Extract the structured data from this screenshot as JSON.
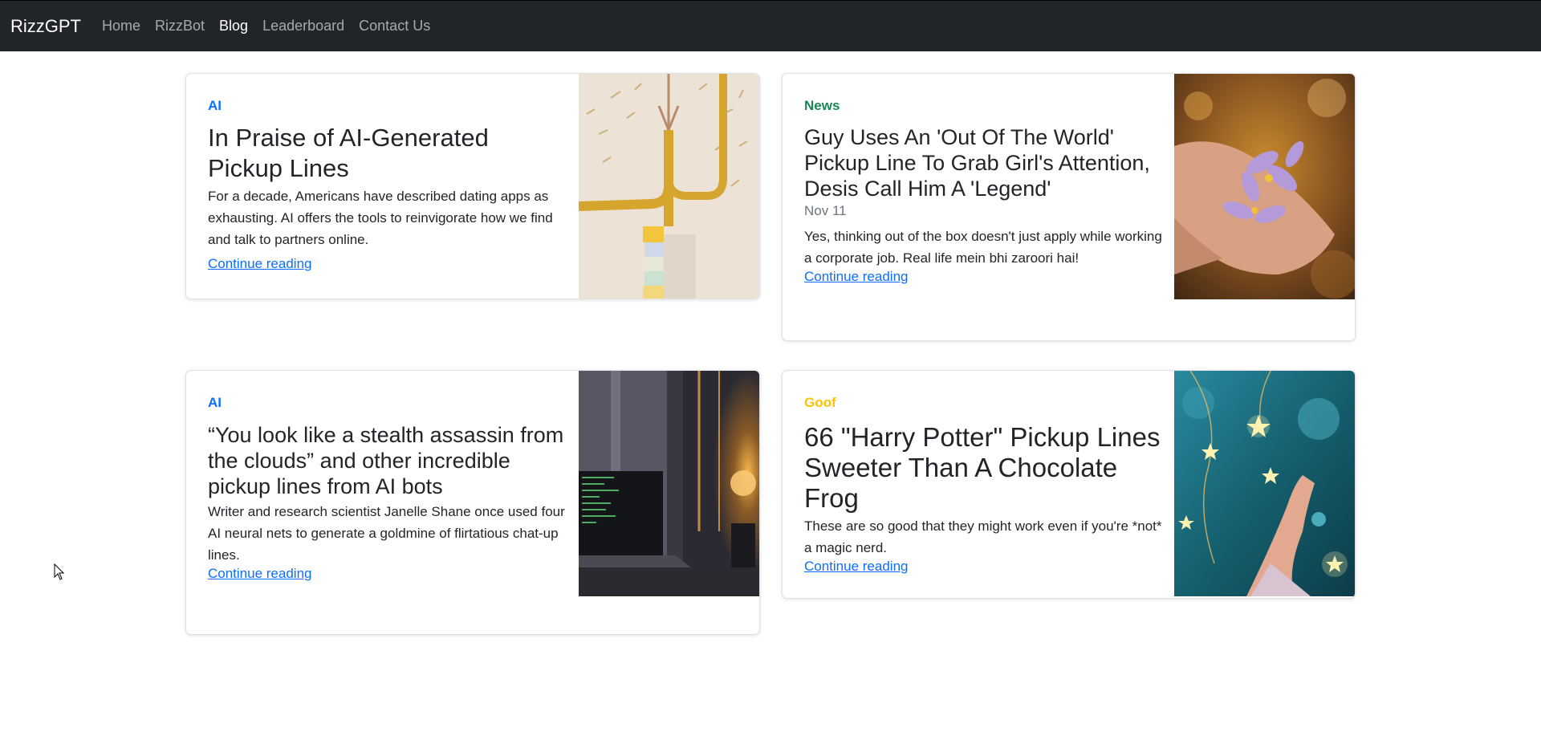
{
  "navbar": {
    "brand": "RizzGPT",
    "links": [
      {
        "label": "Home",
        "active": false
      },
      {
        "label": "RizzBot",
        "active": false
      },
      {
        "label": "Blog",
        "active": true
      },
      {
        "label": "Leaderboard",
        "active": false
      },
      {
        "label": "Contact Us",
        "active": false
      }
    ]
  },
  "posts": [
    {
      "category": "AI",
      "category_color": "#0d6efd",
      "title": "In Praise of AI-Generated Pickup Lines",
      "date": "",
      "excerpt": "For a decade, Americans have described dating apps as exhausting. AI offers the tools to reinvigorate how we find and talk to partners online.",
      "link": "Continue reading",
      "image": "toy-train-tracks-photo"
    },
    {
      "category": "News",
      "category_color": "#198754",
      "title": "Guy Uses An 'Out Of The World' Pickup Line To Grab Girl's Attention, Desis Call Him A 'Legend'",
      "date": "Nov 11",
      "excerpt": "Yes, thinking out of the box doesn't just apply while working a corporate job. Real life mein bhi zaroori hai!",
      "link": "Continue reading",
      "image": "hand-holding-purple-flowers-photo"
    },
    {
      "category": "AI",
      "category_color": "#0d6efd",
      "title": "“You look like a stealth assassin from the clouds” and other incredible pickup lines from AI bots",
      "date": "",
      "excerpt": "Writer and research scientist Janelle Shane once used four AI neural nets to generate a goldmine of flirtatious chat-up lines.",
      "link": "Continue reading",
      "image": "laptop-and-lamp-photo"
    },
    {
      "category": "Goof",
      "category_color": "#ffc107",
      "title": "66 \"Harry Potter\" Pickup Lines Sweeter Than A Chocolate Frog",
      "date": "",
      "excerpt": "These are so good that they might work even if you're *not* a magic nerd.",
      "link": "Continue reading",
      "image": "hand-reaching-star-lights-photo"
    }
  ]
}
